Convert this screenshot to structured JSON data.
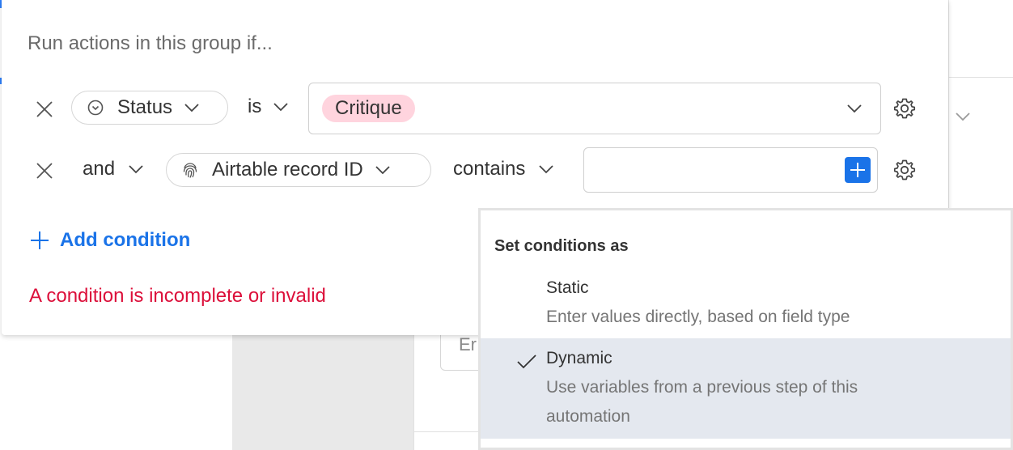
{
  "panel": {
    "title": "Run actions in this group if...",
    "conditions": [
      {
        "field": "Status",
        "operator": "is",
        "value_tag": "Critique",
        "field_icon": "status-circle-chevron-icon"
      },
      {
        "conjunction": "and",
        "field": "Airtable record ID",
        "operator": "contains",
        "value": "",
        "field_icon": "fingerprint-icon"
      }
    ],
    "add_condition_label": "Add condition",
    "error_message": "A condition is incomplete or invalid"
  },
  "background": {
    "input_fragment": "Er"
  },
  "popup": {
    "title": "Set conditions as",
    "options": [
      {
        "label": "Static",
        "description": "Enter values directly, based on field type",
        "selected": false
      },
      {
        "label": "Dynamic",
        "description": "Use variables from a previous step of this automation",
        "selected": true
      }
    ]
  },
  "colors": {
    "accent": "#1a73e8",
    "error": "#dc0f3a",
    "tag_pink": "#ffd4de",
    "selected_bg": "#e4e8ef"
  }
}
